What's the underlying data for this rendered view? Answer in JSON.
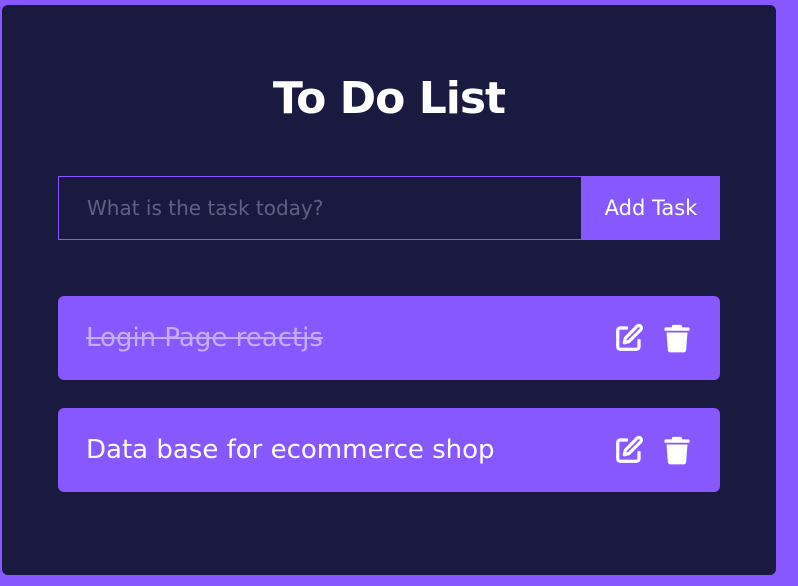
{
  "app": {
    "title": "To Do List"
  },
  "form": {
    "input_value": "",
    "input_placeholder": "What is the task today?",
    "add_label": "Add Task"
  },
  "todos": [
    {
      "text": "Login Page reactjs",
      "completed": true
    },
    {
      "text": "Data base for ecommerce shop",
      "completed": false
    }
  ],
  "icons": {
    "edit": "edit-icon",
    "delete": "trash-icon"
  },
  "colors": {
    "background": "#8758ff",
    "card": "#1a1a40",
    "accent": "#8758ff",
    "text": "#ffffff",
    "placeholder": "#5e6180",
    "completed_text": "#c5aeff"
  }
}
